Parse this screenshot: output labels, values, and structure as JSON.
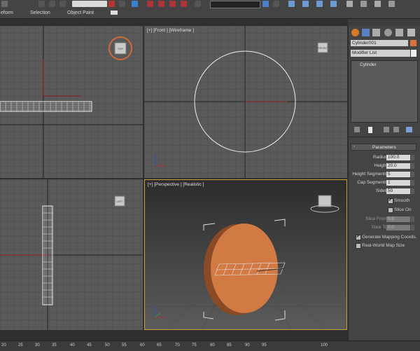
{
  "ribbon": {
    "items": [
      "eform",
      "Selection",
      "Object Paint"
    ]
  },
  "viewports": {
    "front_label": "[+] [Front ] [Wireframe ]",
    "perspective_label": "[+] [Perspective ] [Realistic ]",
    "viewcube_top": "TOP",
    "viewcube_front": "FRONT",
    "viewcube_left": "LEFT"
  },
  "command_panel": {
    "object_name": "Cylinder001",
    "modifier_list": "Modifier List",
    "stack_item": "Cylinder",
    "rollout_title": "Parameters",
    "params": [
      {
        "label": "Radius:",
        "value": "100.0"
      },
      {
        "label": "Height:",
        "value": "20.0"
      },
      {
        "label": "Height Segments:",
        "value": "5"
      },
      {
        "label": "Cap Segments:",
        "value": "1"
      },
      {
        "label": "Sides:",
        "value": "50"
      }
    ],
    "smooth": "Smooth",
    "slice_on": "Slice On",
    "slice_from_label": "Slice From:",
    "slice_from_value": "0.0",
    "slice_to_label": "Slice To:",
    "slice_to_value": "0.0",
    "gen_mapping": "Generate Mapping Coords.",
    "real_world": "Real-World Map Size",
    "colors": {
      "object_swatch": "#d8733a",
      "panel_bg": "#444444"
    }
  },
  "timeline": {
    "ticks": [
      "20",
      "25",
      "30",
      "35",
      "40",
      "45",
      "50",
      "55",
      "60",
      "65",
      "70",
      "75",
      "80",
      "85",
      "90",
      "95",
      "100"
    ]
  }
}
